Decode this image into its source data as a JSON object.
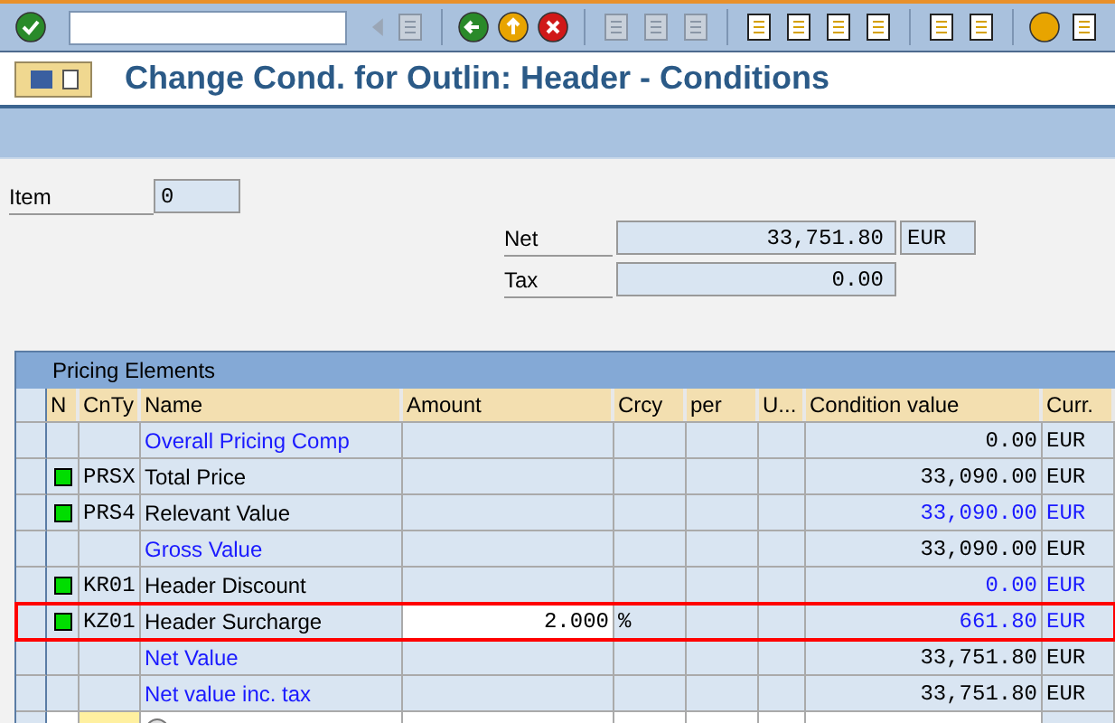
{
  "title": "Change Cond. for Outlin: Header - Conditions",
  "item": {
    "label": "Item",
    "value": "0"
  },
  "totals": [
    {
      "label": "Net",
      "value": "33,751.80",
      "currency": "EUR"
    },
    {
      "label": "Tax",
      "value": "0.00"
    }
  ],
  "table": {
    "title": "Pricing Elements",
    "columns": [
      "N",
      "CnTy",
      "Name",
      "Amount",
      "Crcy",
      "per",
      "U...",
      "Condition value",
      "Curr."
    ],
    "rows": [
      {
        "kind": "subtotal",
        "name": "Overall Pricing Comp",
        "value": "0.00",
        "curr": "EUR",
        "emphasis": false,
        "selected": false
      },
      {
        "kind": "condition",
        "type": "PRSX",
        "name": "Total Price",
        "value": "33,090.00",
        "curr": "EUR",
        "emphasis": false,
        "selected": false
      },
      {
        "kind": "condition",
        "type": "PRS4",
        "name": "Relevant Value",
        "value": "33,090.00",
        "curr": "EUR",
        "emphasis": true,
        "selected": false
      },
      {
        "kind": "subtotal",
        "name": "Gross Value",
        "value": "33,090.00",
        "curr": "EUR",
        "emphasis": false,
        "selected": false
      },
      {
        "kind": "condition",
        "type": "KR01",
        "name": "Header Discount",
        "value": "0.00",
        "curr": "EUR",
        "emphasis": true,
        "selected": false
      },
      {
        "kind": "condition",
        "type": "KZ01",
        "name": "Header Surcharge",
        "amount": "2.000",
        "crcy": "%",
        "value": "661.80",
        "curr": "EUR",
        "emphasis": true,
        "selected": true
      },
      {
        "kind": "subtotal",
        "name": "Net Value",
        "value": "33,751.80",
        "curr": "EUR",
        "emphasis": false,
        "selected": false
      },
      {
        "kind": "subtotal",
        "name": "Net value inc. tax",
        "value": "33,751.80",
        "curr": "EUR",
        "emphasis": false,
        "selected": false
      },
      {
        "kind": "new"
      }
    ]
  }
}
